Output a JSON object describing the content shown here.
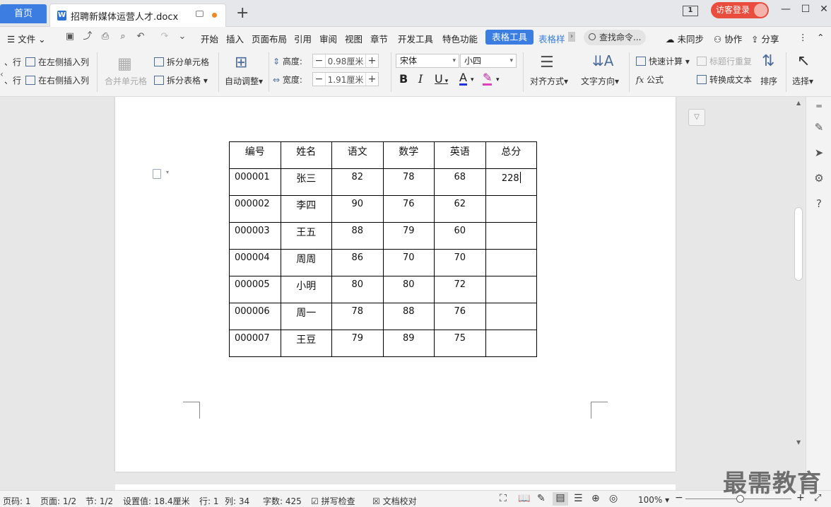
{
  "titlebar": {
    "home_tab": "首页",
    "doc_tab": "招聘新媒体运营人才.docx",
    "page_indicator": "1",
    "login_label": "访客登录"
  },
  "menubar": {
    "file": "文件",
    "items": [
      "开始",
      "插入",
      "页面布局",
      "引用",
      "审阅",
      "视图",
      "章节",
      "开发工具",
      "特色功能"
    ],
    "active_tab": "表格工具",
    "next_tab": "表格样",
    "search": "查找命令...",
    "sync": "未同步",
    "collab": "协作",
    "share": "分享"
  },
  "ribbon": {
    "insert_row_above_fragment": "、行",
    "insert_row_below_fragment": "、行",
    "insert_left_col": "在左侧插入列",
    "insert_right_col": "在右侧插入列",
    "merge_cells": "合并单元格",
    "split_cells": "拆分单元格",
    "split_table": "拆分表格",
    "auto_fit": "自动调整",
    "height_label": "高度:",
    "height_value": "0.98厘米",
    "width_label": "宽度:",
    "width_value": "1.91厘米",
    "font_name": "宋体",
    "font_size": "小四",
    "align": "对齐方式",
    "text_direction": "文字方向",
    "quick_calc": "快速计算",
    "header_repeat": "标题行重复",
    "formula": "公式",
    "to_text": "转换成文本",
    "sort": "排序",
    "select": "选择"
  },
  "table": {
    "headers": [
      "编号",
      "姓名",
      "语文",
      "数学",
      "英语",
      "总分"
    ],
    "rows": [
      [
        "000001",
        "张三",
        "82",
        "78",
        "68",
        "228"
      ],
      [
        "000002",
        "李四",
        "90",
        "76",
        "62",
        ""
      ],
      [
        "000003",
        "王五",
        "88",
        "79",
        "60",
        ""
      ],
      [
        "000004",
        "周周",
        "86",
        "70",
        "70",
        ""
      ],
      [
        "000005",
        "小明",
        "80",
        "80",
        "72",
        ""
      ],
      [
        "000006",
        "周一",
        "78",
        "88",
        "76",
        ""
      ],
      [
        "000007",
        "王豆",
        "79",
        "89",
        "75",
        ""
      ]
    ]
  },
  "statusbar": {
    "page_code": "页码: 1",
    "page": "页面: 1/2",
    "section": "节: 1/2",
    "setting": "设置值: 18.4厘米",
    "row": "行: 1",
    "col": "列: 34",
    "words": "字数: 425",
    "spell": "拼写检查",
    "proof": "文档校对",
    "zoom": "100%"
  },
  "watermark": "最需教育"
}
